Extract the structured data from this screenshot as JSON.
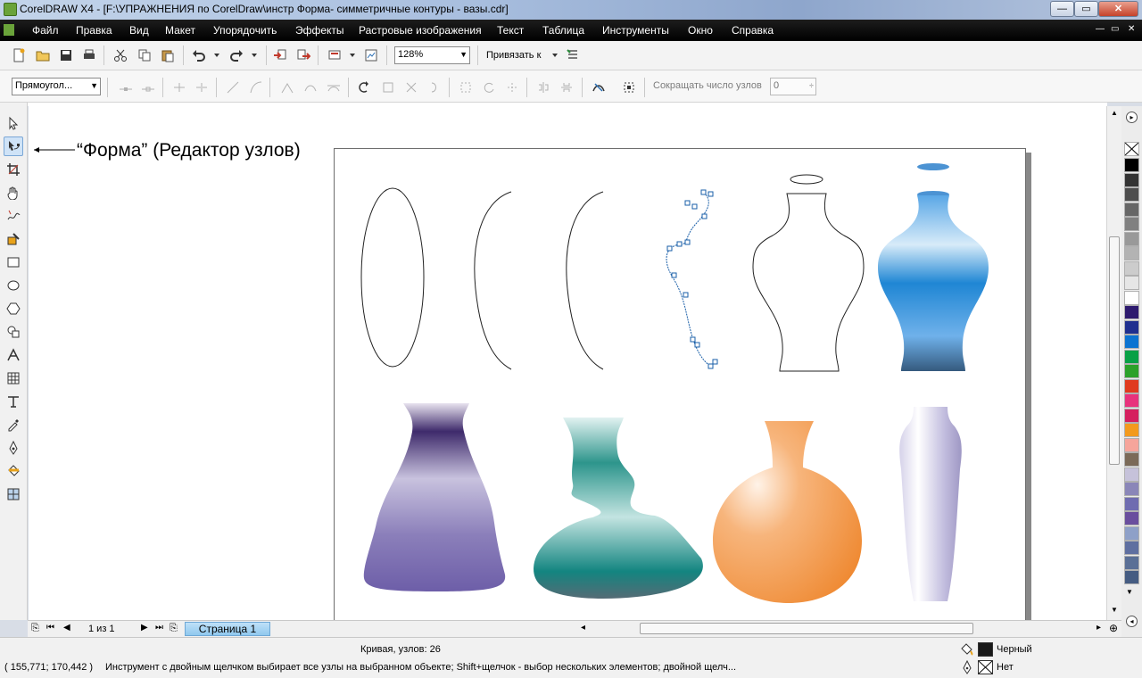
{
  "window": {
    "title": "CorelDRAW X4 - [F:\\УПРАЖНЕНИЯ по CorelDraw\\инстр Форма- симметричные контуры - вазы.cdr]",
    "minimize": "—",
    "restore": "▭",
    "close": "✕"
  },
  "menu": {
    "items": [
      "Файл",
      "Правка",
      "Вид",
      "Макет",
      "Упорядочить",
      "Эффекты",
      "Растровые изображения",
      "Текст",
      "Таблица",
      "Инструменты",
      "Окно",
      "Справка"
    ],
    "right_buttons": [
      "—",
      "▭",
      "✕"
    ]
  },
  "toolbar": {
    "zoom_value": "128%",
    "snap_label": "Привязать к"
  },
  "property_bar": {
    "selection_mode": "Прямоугол...",
    "reduce_nodes_label": "Сокращать число узлов",
    "reduce_nodes_value": "0"
  },
  "canvas": {
    "annotation": "“Форма” (Редактор узлов)",
    "colors": {
      "blue_vase": "#2f8fd8",
      "purple_vase": "#6d5ea8",
      "teal_vase": "#1f8f88",
      "orange_vase": "#f39a4c",
      "lavender_vase": "#b9b3d6"
    }
  },
  "pagebar": {
    "page_counter": "1 из 1",
    "page_tab": "Страница 1"
  },
  "status": {
    "object_info": "Кривая, узлов: 26",
    "coordinates": "( 155,771; 170,442 )",
    "hint": "Инструмент с двойным щелчком выбирает все узлы на выбранном объекте; Shift+щелчок - выбор нескольких элементов; двойной щелч...",
    "fill_label": "Черный",
    "outline_label": "Нет",
    "fill_color": "#1a1a1a"
  },
  "palette": {
    "colors": [
      "#000000",
      "#333333",
      "#4d4d4d",
      "#666666",
      "#808080",
      "#999999",
      "#b3b3b3",
      "#cccccc",
      "#e6e6e6",
      "#ffffff",
      "#2d1a6e",
      "#1f2f8f",
      "#0b73d1",
      "#08a046",
      "#2ca12a",
      "#e03a1e",
      "#e8327c",
      "#d51f5e",
      "#f39a1d",
      "#f6a59b",
      "#7b6a58",
      "#c6c2da",
      "#8a86b8",
      "#6f6cb0",
      "#6a4e9e",
      "#8ea0c8",
      "#5f6fa0",
      "#5a6f96",
      "#455c82"
    ]
  }
}
